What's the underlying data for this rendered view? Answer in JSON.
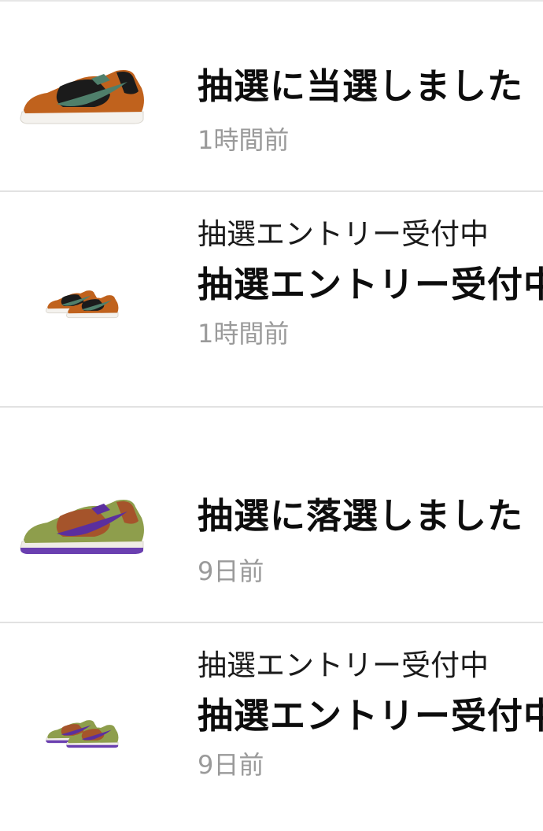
{
  "notifications": [
    {
      "title": "抽選に当選しました",
      "subtitle": "",
      "time": "1時間前",
      "thumbnail_icon": "sneaker-single-icon",
      "colors": {
        "upper": "#c0621d",
        "overlay": "#1b1b1b",
        "swoosh": "#4f7f6b",
        "sole": "#f4f2ee"
      }
    },
    {
      "title": "抽選エントリー受付中",
      "subtitle": "抽選エントリー受付中",
      "time": "1時間前",
      "thumbnail_icon": "sneaker-pair-icon",
      "colors": {
        "upper": "#c0621d",
        "overlay": "#1b1b1b",
        "swoosh": "#4f7f6b",
        "sole": "#f4f2ee"
      }
    },
    {
      "title": "抽選に落選しました",
      "subtitle": "",
      "time": "9日前",
      "thumbnail_icon": "sneaker-single-icon",
      "colors": {
        "upper": "#8e9e4c",
        "overlay": "#a5542b",
        "swoosh": "#5b2f9e",
        "sole": "#efece6"
      }
    },
    {
      "title": "抽選エントリー受付中",
      "subtitle": "抽選エントリー受付中",
      "time": "9日前",
      "thumbnail_icon": "sneaker-pair-icon",
      "colors": {
        "upper": "#8e9e4c",
        "overlay": "#a5542b",
        "swoosh": "#5b2f9e",
        "sole": "#efece6"
      }
    }
  ]
}
